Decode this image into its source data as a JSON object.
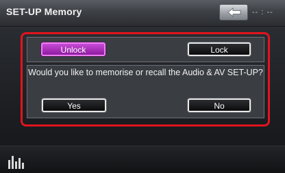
{
  "header": {
    "title": "SET-UP Memory",
    "clock": "-- : --",
    "back_icon": "left-arrow-icon"
  },
  "memory_buttons": {
    "unlock_label": "Unlock",
    "lock_label": "Lock",
    "active": "Unlock"
  },
  "dialog": {
    "prompt": "Would you like to memorise or recall the Audio & AV SET-UP?",
    "yes_label": "Yes",
    "no_label": "No"
  },
  "footer": {
    "eq_icon": "equalizer-bars-icon"
  },
  "colors": {
    "active_button": "#a52bb7",
    "highlight_frame": "#e2141e",
    "panel": "#3a3d42"
  }
}
